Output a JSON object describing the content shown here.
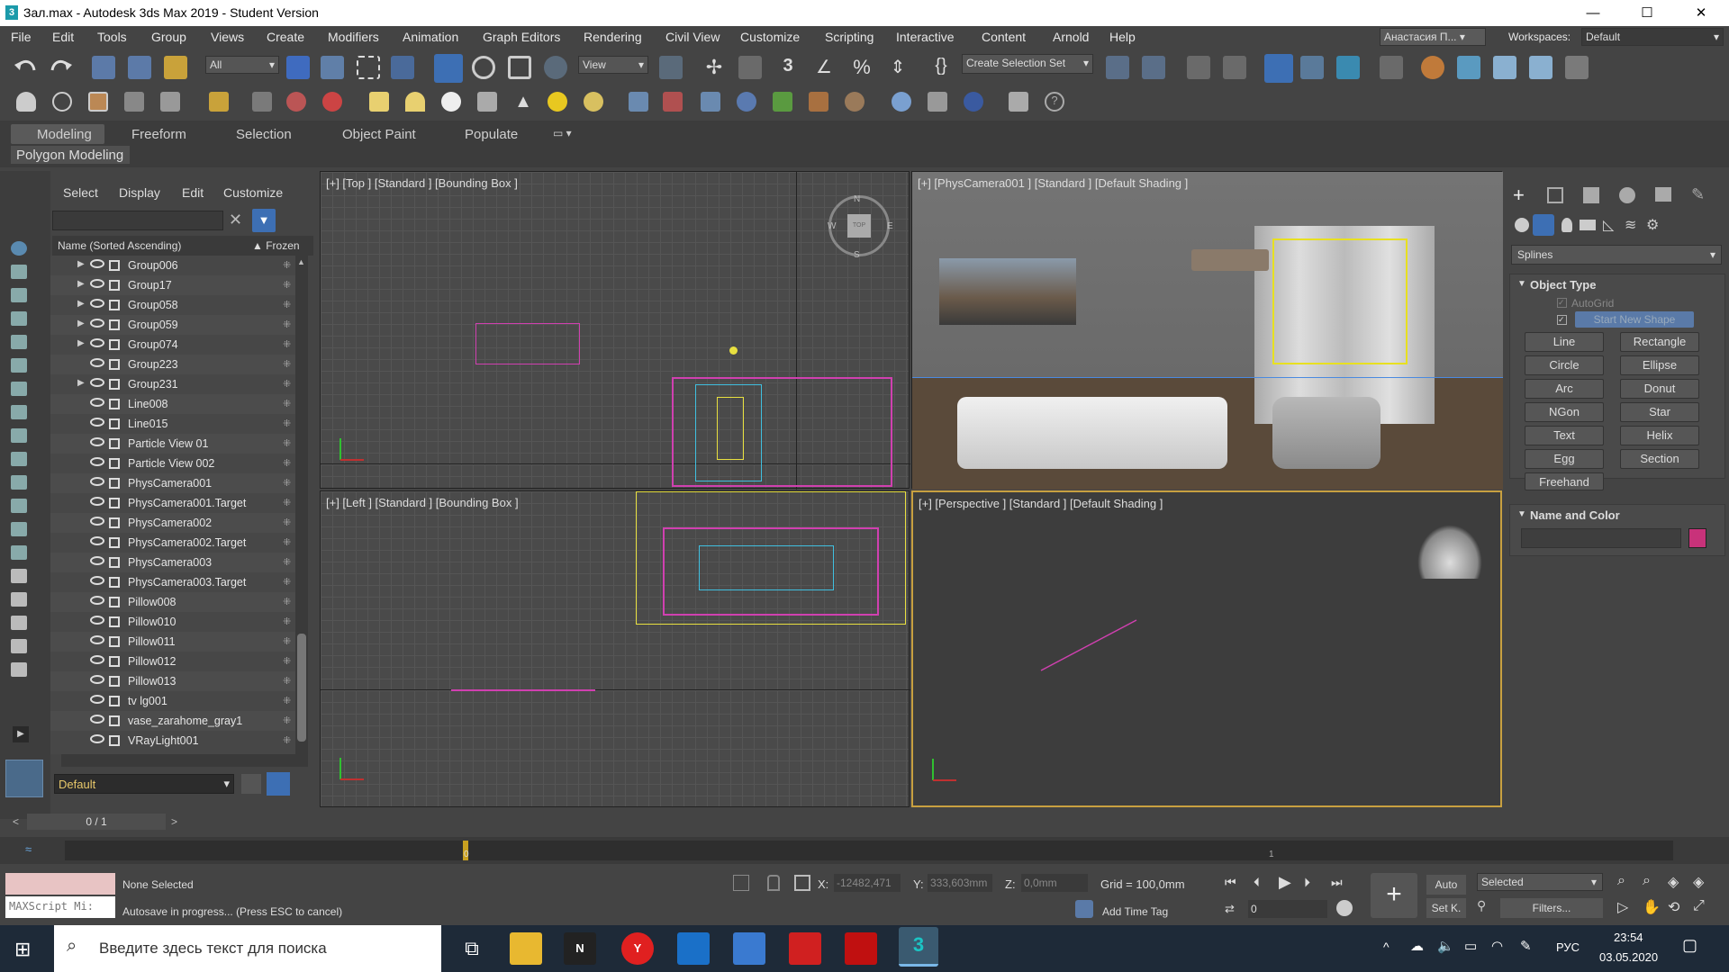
{
  "window": {
    "title": "Зал.max - Autodesk 3ds Max 2019 - Student Version",
    "minimize": "—",
    "maximize": "☐",
    "close": "✕",
    "app_icon": "3"
  },
  "menu": [
    "File",
    "Edit",
    "Tools",
    "Group",
    "Views",
    "Create",
    "Modifiers",
    "Animation",
    "Graph Editors",
    "Rendering",
    "Civil View",
    "Customize",
    "Scripting",
    "Interactive",
    "Content",
    "Arnold",
    "Help"
  ],
  "user": "Анастасия П...",
  "workspaces_label": "Workspaces:",
  "workspace": "Default",
  "toolbar": {
    "filter": "All",
    "ref_coord": "View",
    "selection_set": "Create Selection Set"
  },
  "ribbon": {
    "tabs": [
      "Modeling",
      "Freeform",
      "Selection",
      "Object Paint",
      "Populate"
    ],
    "active": "Modeling",
    "sub": "Polygon Modeling"
  },
  "scene_explorer": {
    "menu": [
      "Select",
      "Display",
      "Edit",
      "Customize"
    ],
    "col_name": "Name (Sorted Ascending)",
    "col_frozen": "▲ Frozen",
    "rows": [
      "Group006",
      "Group17",
      "Group058",
      "Group059",
      "Group074",
      "Group223",
      "Group231",
      "Line008",
      "Line015",
      "Particle View 01",
      "Particle View 002",
      "PhysCamera001",
      "PhysCamera001.Target",
      "PhysCamera002",
      "PhysCamera002.Target",
      "PhysCamera003",
      "PhysCamera003.Target",
      "Pillow008",
      "Pillow010",
      "Pillow011",
      "Pillow012",
      "Pillow013",
      "tv lg001",
      "vase_zarahome_gray1",
      "VRayLight001"
    ],
    "layer": "Default"
  },
  "viewports": {
    "top": "[+] [Top ] [Standard ] [Bounding Box ]",
    "camera": "[+] [PhysCamera001 ] [Standard ] [Default Shading ]",
    "left": "[+] [Left ] [Standard ] [Bounding Box ]",
    "perspective": "[+] [Perspective ] [Standard ] [Default Shading ]"
  },
  "viewcube": {
    "n": "N",
    "s": "S",
    "w": "W",
    "e": "E",
    "face": "TOP"
  },
  "command_panel": {
    "category": "Splines",
    "object_type_title": "Object Type",
    "autogrid": "AutoGrid",
    "start_new_shape": "Start New Shape",
    "buttons": [
      "Line",
      "Rectangle",
      "Circle",
      "Ellipse",
      "Arc",
      "Donut",
      "NGon",
      "Star",
      "Text",
      "Helix",
      "Egg",
      "Section",
      "Freehand"
    ],
    "name_color_title": "Name and Color",
    "color": "#c8327a"
  },
  "timeline": {
    "frame": "0 / 1",
    "marker": "0",
    "tick": "1"
  },
  "status": {
    "selection": "None Selected",
    "message": "Autosave in progress... (Press ESC to cancel)",
    "maxscript": "MAXScript Mi:",
    "x_label": "X:",
    "x": "-12482,471",
    "y_label": "Y:",
    "y": "333,603mm",
    "z_label": "Z:",
    "z": "0,0mm",
    "grid": "Grid = 100,0mm",
    "add_time_tag": "Add Time Tag",
    "auto": "Auto",
    "setk": "Set K.",
    "selected": "Selected",
    "filters": "Filters...",
    "frame_field": "0"
  },
  "taskbar": {
    "search": "Введите здесь текст для поиска",
    "lang": "РУС",
    "time": "23:54",
    "date": "03.05.2020"
  }
}
